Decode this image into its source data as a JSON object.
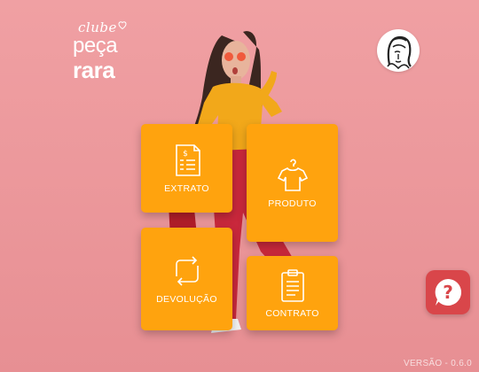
{
  "brand": {
    "line1": "clube",
    "line2": "peça",
    "line3": "rara"
  },
  "menu": [
    {
      "label": "EXTRATO",
      "icon": "receipt-icon"
    },
    {
      "label": "PRODUTO",
      "icon": "tshirt-hanger-icon"
    },
    {
      "label": "DEVOLUÇÃO",
      "icon": "return-arrows-icon"
    },
    {
      "label": "CONTRATO",
      "icon": "clipboard-icon"
    }
  ],
  "help": {
    "icon": "help-chat-icon",
    "glyph": "?"
  },
  "version": "VERSÃO - 0.6.0",
  "colors": {
    "background": "#ee9a9d",
    "tile": "#ffa30e",
    "help": "#d9464a",
    "text": "#ffffff"
  }
}
